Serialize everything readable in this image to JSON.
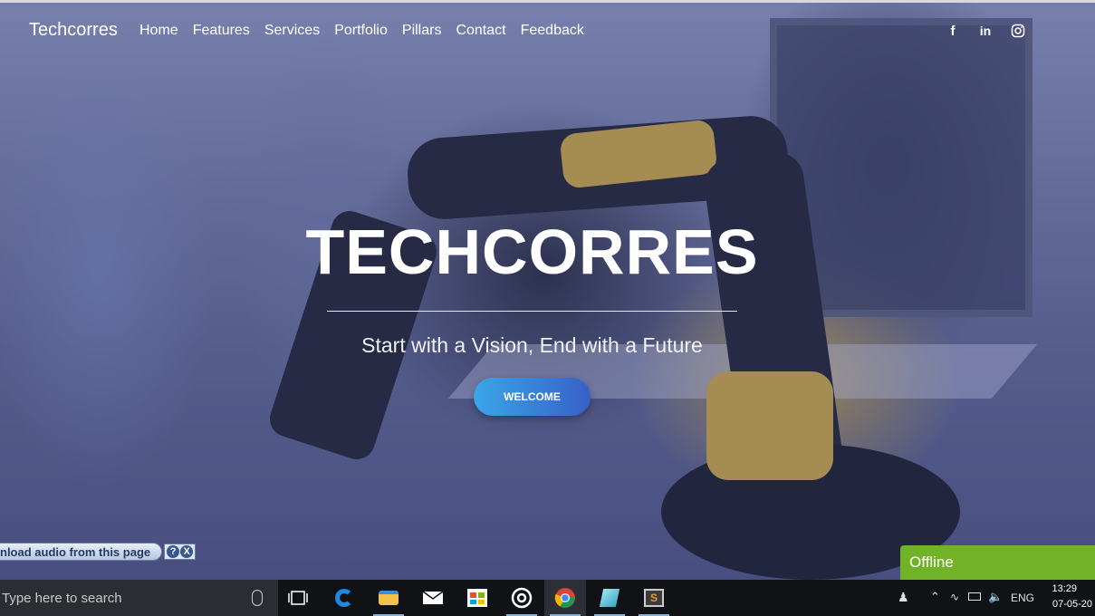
{
  "site": {
    "brand": "Techcorres",
    "nav_items": [
      "Home",
      "Features",
      "Services",
      "Portfolio",
      "Pillars",
      "Contact",
      "Feedback"
    ],
    "social_icons": [
      "facebook-icon",
      "linkedin-icon",
      "instagram-icon"
    ]
  },
  "hero": {
    "title": "TECHCORRES",
    "subtitle": "Start with a Vision, End with a Future",
    "button_label": "WELCOME"
  },
  "audio_bar": {
    "label": "nload audio from this page",
    "help": "?",
    "close": "X"
  },
  "status_badge": {
    "label": "Offline",
    "color": "#72b228"
  },
  "taskbar": {
    "search_placeholder": "Type here to search",
    "apps": [
      "task-view-icon",
      "edge-icon",
      "file-explorer-icon",
      "mail-icon",
      "store-icon",
      "media-player-icon",
      "chrome-icon",
      "app-icon",
      "sublime-icon"
    ],
    "language": "ENG",
    "time": "13:29",
    "date": "07-05-20"
  }
}
